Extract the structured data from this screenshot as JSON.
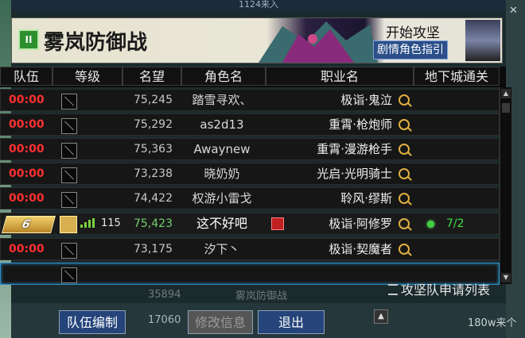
{
  "window_title": "1124来入",
  "banner": {
    "pause_icon": "II",
    "title": "雾岚防御战",
    "start_label": "开始攻坚",
    "guide_label": "剧情角色指引"
  },
  "columns": [
    "队伍",
    "等级",
    "名望",
    "角色名",
    "职业名",
    "地下城通关"
  ],
  "rows": [
    {
      "time": "00:00",
      "reputation": "75,245",
      "name": "踏雪寻欢、",
      "job": "极诣·鬼泣"
    },
    {
      "time": "00:00",
      "reputation": "75,292",
      "name": "as2d13",
      "job": "重霄·枪炮师"
    },
    {
      "time": "00:00",
      "reputation": "75,363",
      "name": "Awaynew",
      "job": "重霄·漫游枪手"
    },
    {
      "time": "00:00",
      "reputation": "73,238",
      "name": "晓奶奶",
      "job": "光启·光明骑士"
    },
    {
      "time": "00:00",
      "reputation": "74,422",
      "name": "权游小雷戈",
      "job": "聆风·缪斯"
    }
  ],
  "me": {
    "badge": "6",
    "level": "115",
    "reputation": "75,423",
    "name": "这不好吧",
    "job": "极诣·阿修罗",
    "dungeon": "7/2"
  },
  "row7": {
    "time": "00:00",
    "reputation": "73,175",
    "name": "汐下丶",
    "job": "极诣·契魔者"
  },
  "apply_list": "攻坚队申请列表",
  "buttons": {
    "team_edit": "队伍编制",
    "modify_info": "修改信息",
    "exit": "退出"
  },
  "background": {
    "num": "17060",
    "right_text": "180w来个",
    "behind_center": "雾岚防御战",
    "num2": "35894"
  },
  "colors": {
    "time_red": "#ff3030",
    "me_green": "#6fd06f",
    "accent_blue": "#24447a"
  }
}
